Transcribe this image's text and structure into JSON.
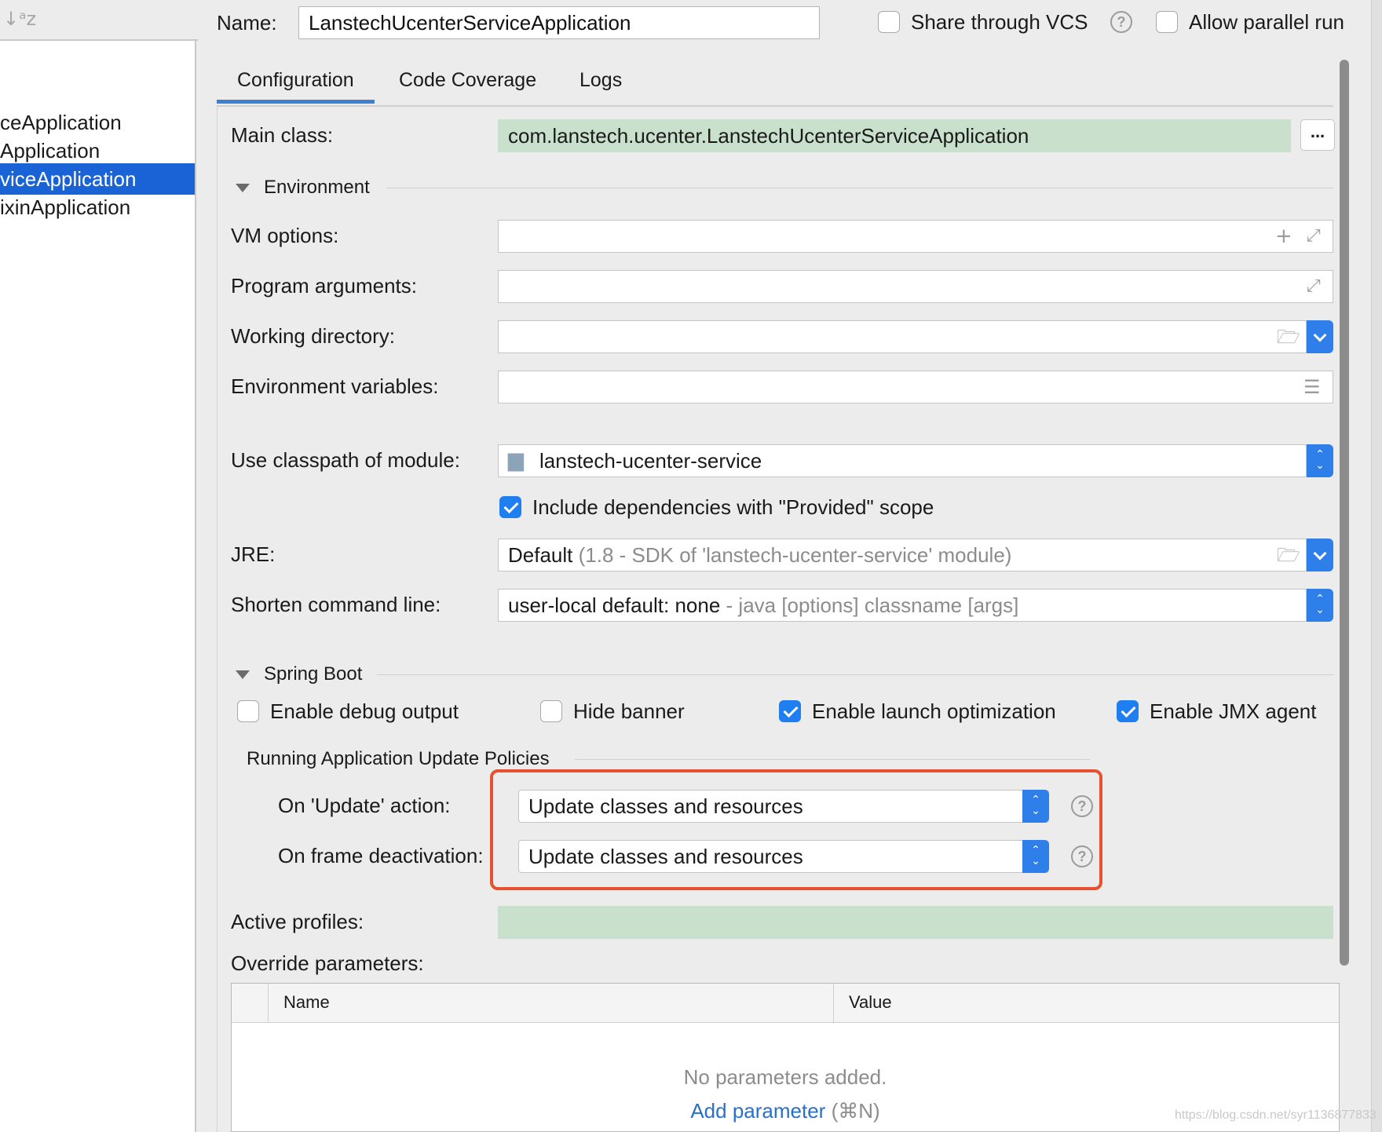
{
  "tree": {
    "items": [
      {
        "label": "ceApplication",
        "selected": false
      },
      {
        "label": "Application",
        "selected": false
      },
      {
        "label": "viceApplication",
        "selected": true
      },
      {
        "label": "ixinApplication",
        "selected": false
      }
    ]
  },
  "header": {
    "name_label": "Name:",
    "name_value": "LanstechUcenterServiceApplication",
    "share_vcs_label": "Share through VCS",
    "share_vcs_checked": false,
    "allow_parallel_label": "Allow parallel run",
    "allow_parallel_checked": false
  },
  "tabs": [
    {
      "label": "Configuration",
      "active": true
    },
    {
      "label": "Code Coverage",
      "active": false
    },
    {
      "label": "Logs",
      "active": false
    }
  ],
  "config": {
    "main_class_label": "Main class:",
    "main_class_value": "com.lanstech.ucenter.LanstechUcenterServiceApplication",
    "browse_label": "...",
    "environment_title": "Environment",
    "vm_options_label": "VM options:",
    "vm_options_value": "",
    "program_args_label": "Program arguments:",
    "program_args_value": "",
    "working_dir_label": "Working directory:",
    "working_dir_value": "",
    "env_vars_label": "Environment variables:",
    "env_vars_value": "",
    "classpath_label": "Use classpath of module:",
    "classpath_value": "lanstech-ucenter-service",
    "include_provided_label": "Include dependencies with \"Provided\" scope",
    "include_provided_checked": true,
    "jre_label": "JRE:",
    "jre_value": "Default",
    "jre_detail": "(1.8 - SDK of 'lanstech-ucenter-service' module)",
    "shorten_label": "Shorten command line:",
    "shorten_value": "user-local default: none",
    "shorten_detail": "- java [options] classname [args]"
  },
  "spring_boot": {
    "title": "Spring Boot",
    "enable_debug_label": "Enable debug output",
    "enable_debug_checked": false,
    "hide_banner_label": "Hide banner",
    "hide_banner_checked": false,
    "launch_opt_label": "Enable launch optimization",
    "launch_opt_checked": true,
    "jmx_label": "Enable JMX agent",
    "jmx_checked": true,
    "update_policies_title": "Running Application Update Policies",
    "on_update_label": "On 'Update' action:",
    "on_update_value": "Update classes and resources",
    "on_frame_label": "On frame deactivation:",
    "on_frame_value": "Update classes and resources",
    "active_profiles_label": "Active profiles:",
    "active_profiles_value": "",
    "override_label": "Override parameters:"
  },
  "override_table": {
    "columns": [
      "Name",
      "Value"
    ],
    "rows": [],
    "empty_text": "No parameters added.",
    "add_link": "Add parameter",
    "add_shortcut": "(⌘N)"
  },
  "watermark": "https://blog.csdn.net/syr1136877833",
  "colors": {
    "selection": "#1a63d7",
    "accent": "#2e7fea",
    "highlight": "#e6512f",
    "field_green": "#c9e1cc"
  }
}
